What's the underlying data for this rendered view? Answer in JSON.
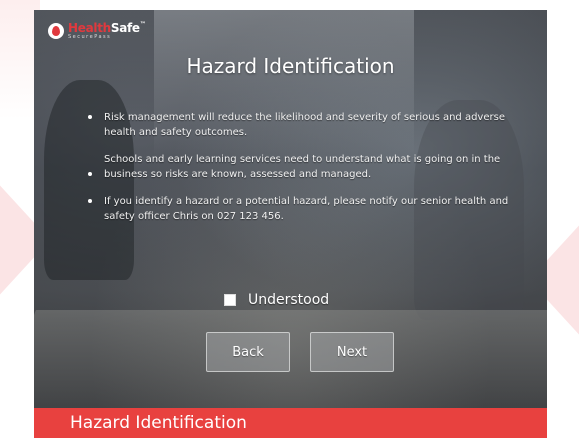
{
  "logo": {
    "brand_part1": "Health",
    "brand_part2": "Safe",
    "tagline": "SecurePass",
    "trademark": "™"
  },
  "slide": {
    "title": "Hazard Identification",
    "bullets": [
      "Risk management will reduce the likelihood and severity of serious and adverse health and safety outcomes.",
      "Schools and early learning services need to understand what is going on in the business so risks are known, assessed and managed.",
      "If you identify a hazard or a potential hazard, please notify our senior health and safety officer Chris on 027 123 456."
    ],
    "checkbox_label": "Understood",
    "checkbox_checked": false,
    "back_label": "Back",
    "next_label": "Next"
  },
  "caption": "Hazard Identification",
  "colors": {
    "accent": "#e8413f",
    "decor": "#fbe4e5"
  }
}
